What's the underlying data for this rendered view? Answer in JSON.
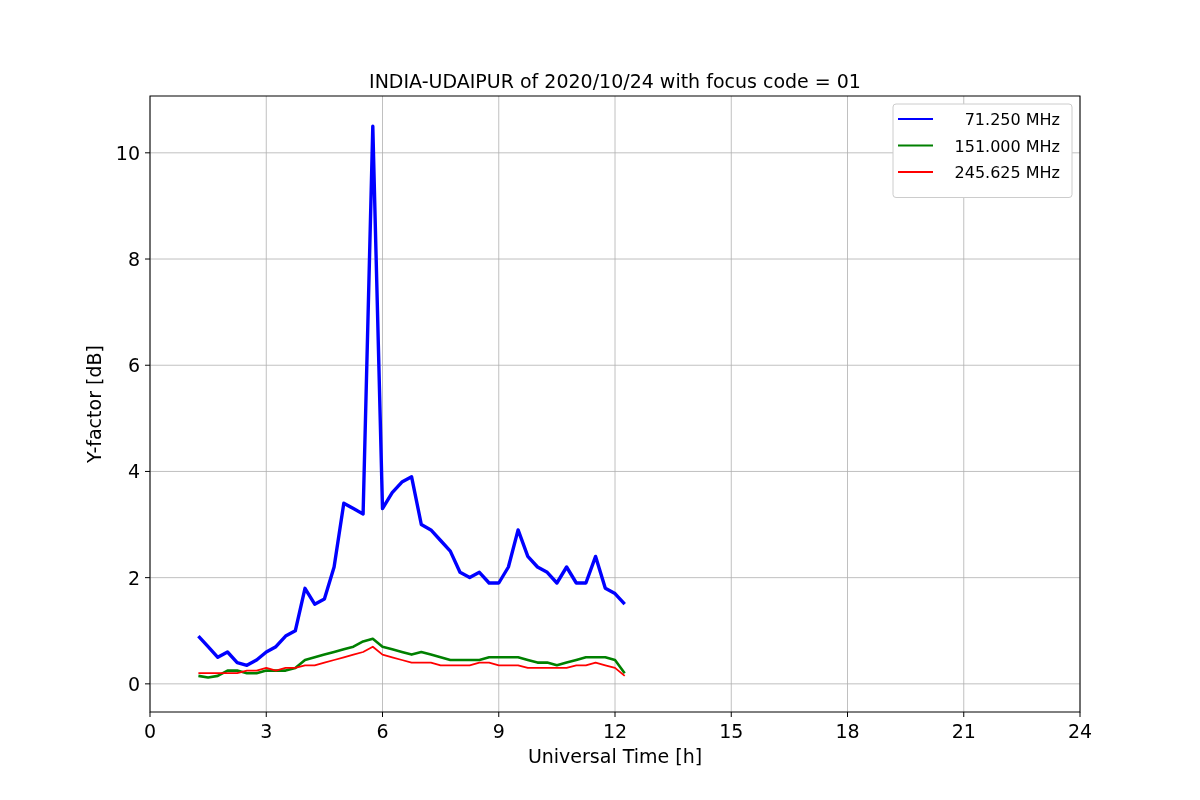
{
  "chart_data": {
    "type": "line",
    "title": "INDIA-UDAIPUR of 2020/10/24 with focus code = 01",
    "xlabel": "Universal Time [h]",
    "ylabel": "Y-factor [dB]",
    "x": [
      1.25,
      1.5,
      1.75,
      2.0,
      2.25,
      2.5,
      2.75,
      3.0,
      3.25,
      3.5,
      3.75,
      4.0,
      4.25,
      4.5,
      4.75,
      5.0,
      5.25,
      5.5,
      5.75,
      6.0,
      6.25,
      6.5,
      6.75,
      7.0,
      7.25,
      7.5,
      7.75,
      8.0,
      8.25,
      8.5,
      8.75,
      9.0,
      9.25,
      9.5,
      9.75,
      10.0,
      10.25,
      10.5,
      10.75,
      11.0,
      11.25,
      11.5,
      11.75,
      12.0,
      12.25
    ],
    "series": [
      {
        "name": "71.250 MHz",
        "color": "#0000ff",
        "values": [
          0.9,
          0.7,
          0.5,
          0.6,
          0.4,
          0.35,
          0.45,
          0.6,
          0.7,
          0.9,
          1.0,
          1.8,
          1.5,
          1.6,
          2.2,
          3.4,
          3.3,
          3.2,
          10.5,
          3.3,
          3.6,
          3.8,
          3.9,
          3.0,
          2.9,
          2.7,
          2.5,
          2.1,
          2.0,
          2.1,
          1.9,
          1.9,
          2.2,
          2.9,
          2.4,
          2.2,
          2.1,
          1.9,
          2.2,
          1.9,
          1.9,
          2.4,
          1.8,
          1.7,
          1.5
        ]
      },
      {
        "name": "151.000 MHz",
        "color": "#008000",
        "values": [
          0.15,
          0.12,
          0.15,
          0.25,
          0.25,
          0.2,
          0.2,
          0.25,
          0.25,
          0.25,
          0.3,
          0.45,
          0.5,
          0.55,
          0.6,
          0.65,
          0.7,
          0.8,
          0.85,
          0.7,
          0.65,
          0.6,
          0.55,
          0.6,
          0.55,
          0.5,
          0.45,
          0.45,
          0.45,
          0.45,
          0.5,
          0.5,
          0.5,
          0.5,
          0.45,
          0.4,
          0.4,
          0.35,
          0.4,
          0.45,
          0.5,
          0.5,
          0.5,
          0.45,
          0.2
        ]
      },
      {
        "name": "245.625 MHz",
        "color": "#ff0000",
        "values": [
          0.2,
          0.2,
          0.2,
          0.2,
          0.2,
          0.25,
          0.25,
          0.3,
          0.25,
          0.3,
          0.3,
          0.35,
          0.35,
          0.4,
          0.45,
          0.5,
          0.55,
          0.6,
          0.7,
          0.55,
          0.5,
          0.45,
          0.4,
          0.4,
          0.4,
          0.35,
          0.35,
          0.35,
          0.35,
          0.4,
          0.4,
          0.35,
          0.35,
          0.35,
          0.3,
          0.3,
          0.3,
          0.3,
          0.3,
          0.35,
          0.35,
          0.4,
          0.35,
          0.3,
          0.15
        ]
      }
    ],
    "xlim": [
      0,
      24
    ],
    "ylim": [
      -0.53,
      11.07
    ],
    "xticks": [
      0,
      3,
      6,
      9,
      12,
      15,
      18,
      21,
      24
    ],
    "yticks": [
      0,
      2,
      4,
      6,
      8,
      10
    ],
    "grid": true,
    "legend": true
  }
}
